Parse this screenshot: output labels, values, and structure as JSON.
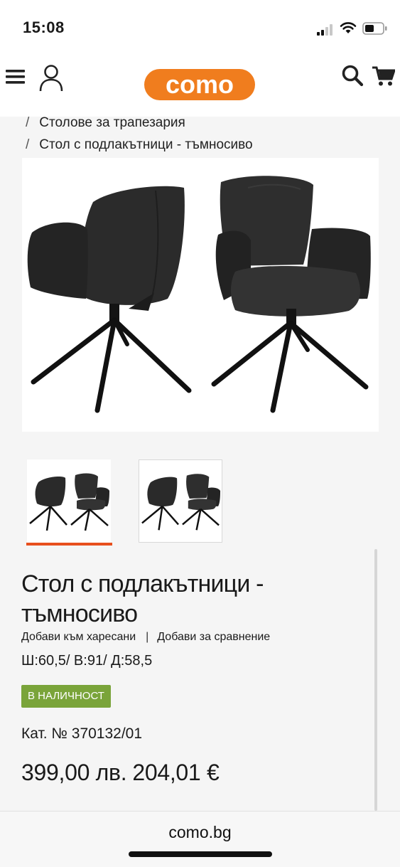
{
  "status_bar": {
    "time": "15:08",
    "icons": [
      "cellular-signal-icon",
      "wifi-icon",
      "battery-icon"
    ]
  },
  "header": {
    "logo_text": "como",
    "brand_color": "#f07d1e",
    "icons": [
      "hamburger-menu-icon",
      "user-icon",
      "search-icon",
      "cart-icon"
    ]
  },
  "breadcrumbs": [
    {
      "separator": "/",
      "label": "Столове за трапезария"
    },
    {
      "separator": "/",
      "label": "Стол с подлакътници - тъмносиво"
    }
  ],
  "gallery": {
    "main_image": "dark-grey-armchair-pair-image",
    "thumbnails": [
      {
        "image": "chair-pair-thumbnail",
        "selected": true
      },
      {
        "image": "chair-pair-thumbnail",
        "selected": false
      }
    ],
    "active_color": "#e8501e"
  },
  "product": {
    "title": "Стол с подлакътници - тъмносиво",
    "add_to_favorites": "Добави към харесани",
    "actions_divider": "|",
    "add_to_compare": "Добави за сравнение",
    "dimensions": "Ш:60,5/ В:91/ Д:58,5",
    "stock_badge": "В НАЛИЧНОСТ",
    "stock_color": "#7aa43a",
    "catalog_number": "Кат. № 370132/01",
    "price_bgn": "399,00 лв.",
    "price_eur": "204,01 €"
  },
  "browser": {
    "url": "como.bg"
  }
}
